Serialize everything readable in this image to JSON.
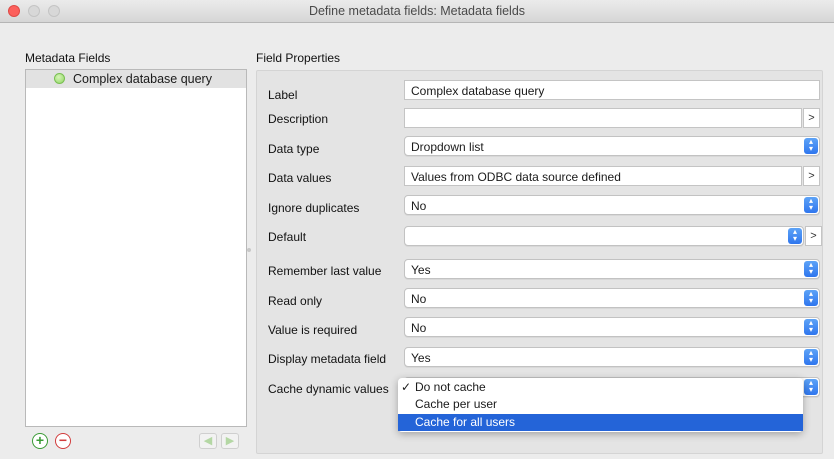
{
  "window": {
    "title": "Define metadata fields: Metadata fields"
  },
  "left_panel": {
    "heading": "Metadata Fields",
    "items": [
      {
        "label": "Complex database query"
      }
    ]
  },
  "right_panel": {
    "heading": "Field Properties",
    "rows": {
      "label": {
        "label": "Label",
        "value": "Complex database query"
      },
      "description": {
        "label": "Description",
        "value": "",
        "button": ">"
      },
      "data_type": {
        "label": "Data type",
        "value": "Dropdown list"
      },
      "data_values": {
        "label": "Data values",
        "value": "Values from ODBC data source defined",
        "button": ">"
      },
      "ignore_duplicates": {
        "label": "Ignore duplicates",
        "value": "No"
      },
      "default": {
        "label": "Default",
        "value": "",
        "button": ">"
      },
      "remember_last": {
        "label": "Remember last value",
        "value": "Yes"
      },
      "read_only": {
        "label": "Read only",
        "value": "No"
      },
      "required": {
        "label": "Value is required",
        "value": "No"
      },
      "display_field": {
        "label": "Display metadata field",
        "value": "Yes"
      },
      "cache": {
        "label": "Cache dynamic values"
      }
    }
  },
  "cache_dropdown": {
    "options": [
      "Do not cache",
      "Cache per user",
      "Cache for all users"
    ],
    "selected": "Do not cache",
    "highlighted": "Cache for all users",
    "check_mark": "✓"
  },
  "icons": {
    "add": "plus-circle-icon",
    "remove": "minus-circle-icon",
    "move_left": "arrow-left-icon",
    "move_right": "arrow-right-icon",
    "stepper": "chevron-up-down-icon"
  },
  "colors": {
    "accent": "#2464d8",
    "stepper": "#2f76ee",
    "add": "#3a9b35",
    "remove": "#d23c3c",
    "close_light": "#fc605c"
  }
}
